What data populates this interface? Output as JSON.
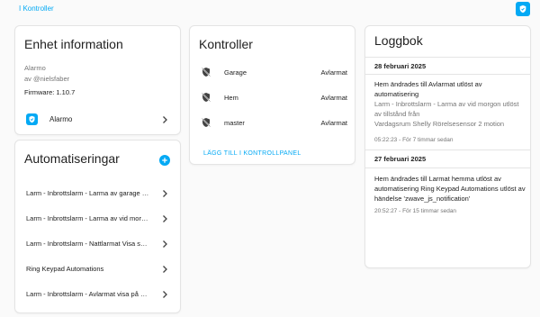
{
  "breadcrumb": {
    "label": "I Kontroller"
  },
  "colors": {
    "accent": "#03a9f4",
    "text": "#212121",
    "secondary": "#757575"
  },
  "device_card": {
    "title": "Enhet information",
    "model": "Alarmo",
    "author": "av @nielsfaber",
    "firmware": "Firmware: 1.10.7",
    "integration_label": "Alarmo",
    "integration_icon": "alarmo-shield-icon"
  },
  "automations_card": {
    "title": "Automatiseringar",
    "items": [
      {
        "label": "Larm - Inbrottslarm - Larma av garage …"
      },
      {
        "label": "Larm - Inbrottslarm - Larma av vid mor…"
      },
      {
        "label": "Larm - Inbrottslarm - Nattlarmat Visa s…"
      },
      {
        "label": "Ring Keypad Automations"
      },
      {
        "label": "Larm - Inbrottslarm - Avlarmat visa på …"
      }
    ]
  },
  "controls_card": {
    "title": "Kontroller",
    "rows": [
      {
        "name": "Garage",
        "state": "Avlarmat",
        "icon": "shield-off-icon"
      },
      {
        "name": "Hem",
        "state": "Avlarmat",
        "icon": "shield-off-icon"
      },
      {
        "name": "master",
        "state": "Avlarmat",
        "icon": "shield-off-icon"
      }
    ],
    "add_link": "LÄGG TILL I KONTROLLPANEL"
  },
  "logbook_card": {
    "title": "Loggbok",
    "groups": [
      {
        "date": "28 februari 2025",
        "text": "Hem ändrades till Avlarmat utlöst av automatisering",
        "source": "Larm - Inbrottslarm - Larma av vid morgon utlöst av tillstånd från",
        "source2": "Vardagsrum Shelly Rörelsesensor 2 motion",
        "meta": "05:22:23 - För 7 timmar sedan"
      },
      {
        "date": "27 februari 2025",
        "text": "Hem ändrades till Larmat hemma utlöst av automatisering Ring Keypad Automations utlöst av händelse 'zwave_js_notification'",
        "meta": "20:52:27 - För 15 timmar sedan"
      }
    ]
  }
}
